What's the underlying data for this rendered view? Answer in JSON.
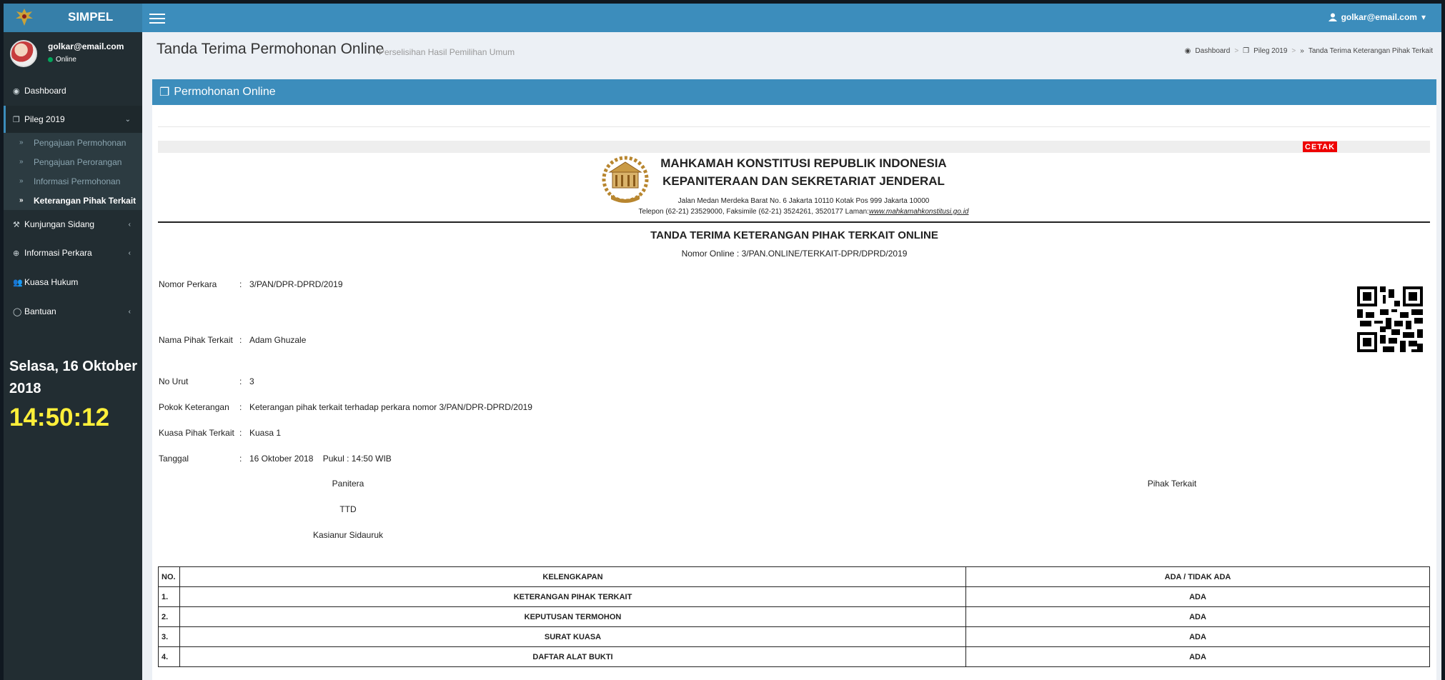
{
  "app": {
    "name": "SIMPEL"
  },
  "topbar": {
    "user_email": "golkar@email.com",
    "caret": "▾"
  },
  "sidebar": {
    "user_email": "golkar@email.com",
    "status": "Online",
    "menu": [
      {
        "label": "Dashboard",
        "icon": "dashboard-icon"
      },
      {
        "label": "Pileg 2019",
        "icon": "copy-icon"
      },
      {
        "label": "Kunjungan Sidang",
        "icon": "gavel-icon"
      },
      {
        "label": "Informasi Perkara",
        "icon": "search-plus-icon"
      },
      {
        "label": "Kuasa Hukum",
        "icon": "users-icon"
      },
      {
        "label": "Bantuan",
        "icon": "comment-icon"
      }
    ],
    "submenu": [
      {
        "label": "Pengajuan Permohonan"
      },
      {
        "label": "Pengajuan Perorangan"
      },
      {
        "label": "Informasi Permohonan"
      },
      {
        "label": "Keterangan Pihak Terkait"
      }
    ],
    "date": "Selasa, 16 Oktober 2018",
    "time": "14:50:12"
  },
  "header": {
    "title": "Tanda Terima Permohonan Online",
    "subtitle": "Perselisihan Hasil Pemilihan Umum",
    "breadcrumb": [
      "Dashboard",
      "Pileg 2019",
      "Tanda Terima Keterangan Pihak Terkait"
    ]
  },
  "box": {
    "title": "Permohonan Online"
  },
  "document": {
    "print_label": "CETAK",
    "kop_line1": "MAHKAMAH KONSTITUSI REPUBLIK INDONESIA",
    "kop_line2": "KEPANITERAAN DAN SEKRETARIAT JENDERAL",
    "address": "Jalan Medan Merdeka Barat No. 6 Jakarta 10110 Kotak Pos 999 Jakarta 10000",
    "contact": "Telepon (62-21) 23529000, Faksimile (62-21) 3524261, 3520177 Laman:",
    "website": "www.mahkamahkonstitusi.go.id",
    "title": "TANDA TERIMA KETERANGAN PIHAK TERKAIT ONLINE",
    "online_number": "Nomor Online : 3/PAN.ONLINE/TERKAIT-DPR/DPRD/2019",
    "fields": [
      {
        "label": "Nomor Perkara",
        "value": "3/PAN/DPR-DPRD/2019"
      },
      {
        "label": "Nama Pihak Terkait",
        "value": "Adam Ghuzale"
      },
      {
        "label": "No Urut",
        "value": "3"
      },
      {
        "label": "Pokok Keterangan",
        "value": "Keterangan pihak terkait terhadap perkara nomor 3/PAN/DPR-DPRD/2019"
      },
      {
        "label": "Kuasa Pihak Terkait",
        "value": "Kuasa 1"
      },
      {
        "label": "Tanggal",
        "value": "16 Oktober 2018    Pukul : 14:50 WIB"
      }
    ],
    "colon": ":",
    "signature": {
      "left_role": "Panitera",
      "left_sign": "TTD",
      "left_name": "Kasianur Sidauruk",
      "right_role": "Pihak Terkait"
    },
    "table": {
      "headers": [
        "NO.",
        "KELENGKAPAN",
        "ADA / TIDAK ADA"
      ],
      "rows": [
        [
          "1.",
          "KETERANGAN PIHAK TERKAIT",
          "ADA"
        ],
        [
          "2.",
          "KEPUTUSAN TERMOHON",
          "ADA"
        ],
        [
          "3.",
          "SURAT KUASA",
          "ADA"
        ],
        [
          "4.",
          "DAFTAR ALAT BUKTI",
          "ADA"
        ]
      ]
    }
  },
  "colors": {
    "primary": "#3c8dbc",
    "sidebar": "#222d32",
    "clock": "#ffef3a",
    "print": "#ee0000"
  }
}
